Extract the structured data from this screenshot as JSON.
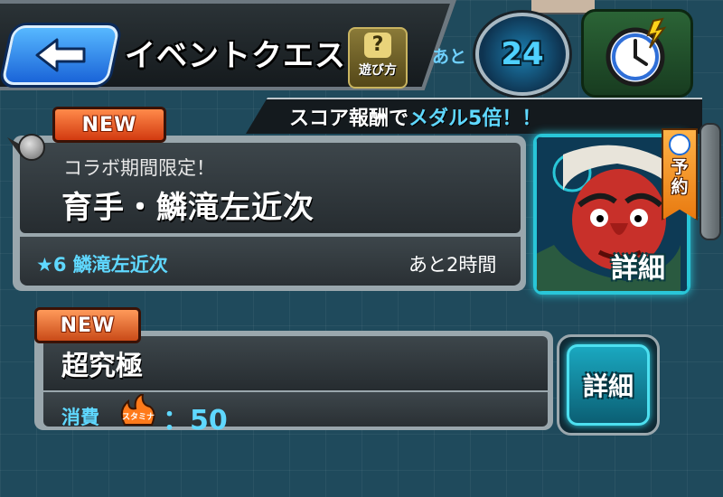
{
  "header": {
    "back_icon": "arrow-left-icon",
    "title": "イベントクエスト",
    "help": {
      "icon": "question-icon",
      "symbol": "?",
      "label": "遊び方"
    },
    "remaining_label": "あと",
    "timer_value": "24",
    "clock_icon": "alarm-clock-icon"
  },
  "banner": {
    "prefix": "スコア報酬で",
    "highlight": "メダル5倍！！"
  },
  "quests": [
    {
      "badge": "NEW",
      "subtitle": "コラボ期間限定！",
      "title": "育手・鱗滝左近次",
      "character": "★6 鱗滝左近次",
      "time_left": "あと2時間",
      "detail_label": "詳細",
      "reserve_label": "予約",
      "reserve_icon": "clock-icon"
    },
    {
      "badge": "NEW",
      "title": "超究極",
      "cost_label": "消費",
      "stamina_icon": "stamina-icon",
      "stamina_text": "スタミナ",
      "cost_value": "：50",
      "detail_label": "詳細"
    }
  ],
  "colors": {
    "accent": "#5fd8ff",
    "badge": "#e0501c",
    "background": "#1f4a5c"
  }
}
